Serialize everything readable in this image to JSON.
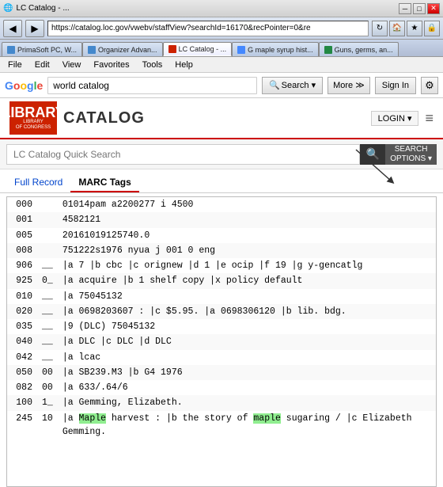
{
  "window": {
    "title": "LC Catalog",
    "controls": [
      "minimize",
      "maximize",
      "close"
    ]
  },
  "address_bar": {
    "url": "https://catalog.loc.gov/vwebv/staffView?searchId=16170&recPointer=0&re",
    "nav_back": "◀",
    "nav_forward": "▶"
  },
  "tabs": [
    {
      "id": "primasoft",
      "label": "PrimaSoft PC, W...",
      "favicon": "primasoft",
      "active": false
    },
    {
      "id": "organizer",
      "label": "Organizer Advan...",
      "favicon": "organizer",
      "active": false
    },
    {
      "id": "lc-catalog",
      "label": "LC Catalog - ...",
      "favicon": "lc",
      "active": true
    },
    {
      "id": "google",
      "label": "G maple syrup hist...",
      "favicon": "google",
      "active": false
    },
    {
      "id": "guns",
      "label": "Guns, germs, an...",
      "favicon": "book",
      "active": false
    }
  ],
  "menu": {
    "items": [
      "File",
      "Edit",
      "View",
      "Favorites",
      "Tools",
      "Help"
    ]
  },
  "google_bar": {
    "logo": "Google",
    "search_value": "world catalog",
    "search_btn": "Search ▾",
    "more_btn": "More ≫",
    "signin_btn": "Sign In",
    "settings_icon": "⚙"
  },
  "lc_header": {
    "logo_text": "LIBRARY",
    "logo_subtext": "LIBRARY\nOF CONGRESS",
    "catalog_label": "CATALOG",
    "login_btn": "LOGIN ▾",
    "hamburger": "≡"
  },
  "search_bar": {
    "placeholder": "LC Catalog Quick Search",
    "search_icon": "🔍",
    "search_options_line1": "SEARCH",
    "search_options_line2": "OPTIONS ▾"
  },
  "record_tabs": [
    {
      "id": "full-record",
      "label": "Full Record",
      "active": false
    },
    {
      "id": "marc-tags",
      "label": "MARC Tags",
      "active": true
    }
  ],
  "marc_records": [
    {
      "tag": "000",
      "ind1": "",
      "ind2": "",
      "data": "01014pam a2200277 i 4500"
    },
    {
      "tag": "001",
      "ind1": "",
      "ind2": "",
      "data": "4582121"
    },
    {
      "tag": "005",
      "ind1": "",
      "ind2": "",
      "data": "20161019125740.0"
    },
    {
      "tag": "008",
      "ind1": "",
      "ind2": "",
      "data": "751222s1976  nyua  j    001 0 eng"
    },
    {
      "tag": "906",
      "ind1": "__",
      "ind2": "",
      "data": "|a 7 |b cbc |c orignew |d 1 |e ocip |f 19 |g y-gencatlg"
    },
    {
      "tag": "925",
      "ind1": "0_",
      "ind2": "",
      "data": "|a acquire |b 1 shelf copy |x policy default"
    },
    {
      "tag": "010",
      "ind1": "__",
      "ind2": "",
      "data": "|a  75045132"
    },
    {
      "tag": "020",
      "ind1": "__",
      "ind2": "",
      "data": "|a 0698203607 : |c $5.95. |a 0698306120 |b lib. bdg."
    },
    {
      "tag": "035",
      "ind1": "__",
      "ind2": "",
      "data": "|9 (DLC) 75045132"
    },
    {
      "tag": "040",
      "ind1": "__",
      "ind2": "",
      "data": "|a DLC |c DLC |d DLC"
    },
    {
      "tag": "042",
      "ind1": "__",
      "ind2": "",
      "data": "|a lcac"
    },
    {
      "tag": "050",
      "ind1": "00",
      "ind2": "",
      "data": "|a SB239.M3 |b G4 1976"
    },
    {
      "tag": "082",
      "ind1": "00",
      "ind2": "",
      "data": "|a 633/.64/6"
    },
    {
      "tag": "100",
      "ind1": "1_",
      "ind2": "",
      "data": "|a Gemming, Elizabeth."
    },
    {
      "tag": "245",
      "ind1": "10",
      "ind2": "",
      "data": "|a Maple harvest : |b the story of maple sugaring / |c Elizabeth Gemming."
    }
  ],
  "highlight_words": [
    "Maple",
    "maple"
  ]
}
